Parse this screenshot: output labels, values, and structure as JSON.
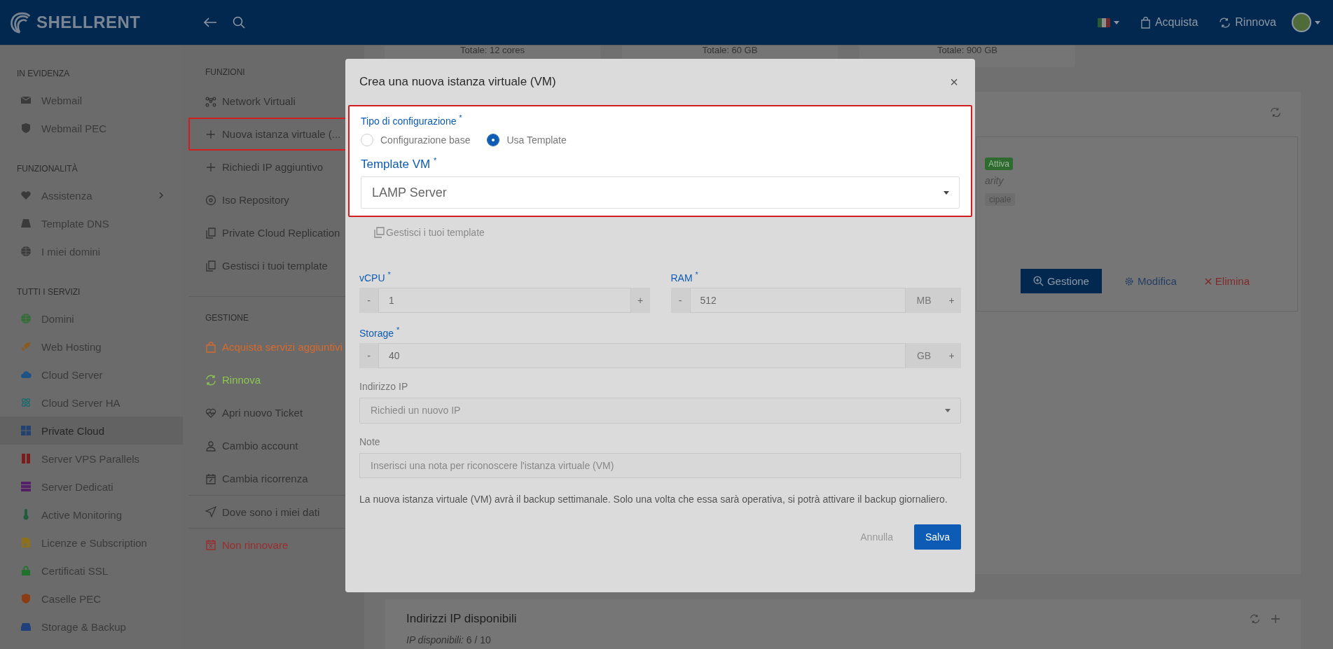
{
  "header": {
    "logo": "SHELLRENT",
    "nav": [
      {
        "label": "Acquista",
        "kind": "bag"
      },
      {
        "label": "Rinnova",
        "kind": "refresh"
      }
    ]
  },
  "sidebar": {
    "sections": [
      {
        "title": "IN EVIDENZA",
        "items": [
          {
            "label": "Webmail",
            "selected": false,
            "submenu": false
          },
          {
            "label": "Webmail PEC",
            "selected": false,
            "submenu": false
          }
        ]
      },
      {
        "title": "FUNZIONALITÀ",
        "items": [
          {
            "label": "Assistenza",
            "selected": false,
            "submenu": true
          },
          {
            "label": "Template DNS",
            "selected": false,
            "submenu": false
          },
          {
            "label": "I miei domini",
            "selected": false,
            "submenu": false
          }
        ]
      },
      {
        "title": "TUTTI I SERVIZI",
        "items": [
          {
            "label": "Domini",
            "selected": false,
            "submenu": false,
            "color": "#2f6e34"
          },
          {
            "label": "Web Hosting",
            "selected": false,
            "submenu": false,
            "color": "#8c5a1c"
          },
          {
            "label": "Cloud Server",
            "selected": false,
            "submenu": false,
            "color": "#1f5388"
          },
          {
            "label": "Cloud Server HA",
            "selected": false,
            "submenu": false,
            "color": "#1c6b6e"
          },
          {
            "label": "Private Cloud",
            "selected": true,
            "submenu": false,
            "color": "#24426e"
          },
          {
            "label": "Server VPS Parallels",
            "selected": false,
            "submenu": false,
            "color": "#7c1d1d"
          },
          {
            "label": "Server Dedicati",
            "selected": false,
            "submenu": false,
            "color": "#552067"
          },
          {
            "label": "Active Monitoring",
            "selected": false,
            "submenu": false,
            "color": "#1f5c3c"
          },
          {
            "label": "Licenze e Subscription",
            "selected": false,
            "submenu": false,
            "color": "#8c701e"
          },
          {
            "label": "Certificati SSL",
            "selected": false,
            "submenu": false,
            "color": "#1f722b"
          },
          {
            "label": "Caselle PEC",
            "selected": false,
            "submenu": false,
            "color": "#8c3c12"
          },
          {
            "label": "Storage & Backup",
            "selected": false,
            "submenu": false,
            "color": "#20407c"
          }
        ]
      }
    ]
  },
  "functions": {
    "sections": [
      {
        "title": "FUNZIONI",
        "items": [
          {
            "label": "Network Virtuali",
            "highlighted": false,
            "divider_before": false
          },
          {
            "label": "Nuova istanza virtuale (...",
            "highlighted": true,
            "divider_before": false
          },
          {
            "label": "Richiedi IP aggiuntivo",
            "highlighted": false,
            "divider_before": false
          },
          {
            "label": "Iso Repository",
            "highlighted": false,
            "divider_before": false
          },
          {
            "label": "Private Cloud Replication",
            "highlighted": false,
            "divider_before": false
          },
          {
            "label": "Gestisci i tuoi template",
            "highlighted": false,
            "divider_before": false
          }
        ]
      },
      {
        "title": "GESTIONE",
        "items": [
          {
            "label": "Acquista servizi aggiuntivi",
            "highlighted": false,
            "divider_before": false,
            "color": "#d86a2c"
          },
          {
            "label": "Rinnova",
            "highlighted": false,
            "divider_before": false,
            "color": "#8cc850"
          },
          {
            "label": "Apri nuovo Ticket",
            "highlighted": false,
            "divider_before": false
          },
          {
            "label": "Cambio account",
            "highlighted": false,
            "divider_before": false
          },
          {
            "label": "Cambia ricorrenza",
            "highlighted": false,
            "divider_before": false
          },
          {
            "label": "Dove sono i miei dati",
            "highlighted": false,
            "divider_before": true
          },
          {
            "label": "Non rinnovare",
            "highlighted": false,
            "divider_before": true,
            "color": "#9c2c2c"
          }
        ]
      }
    ]
  },
  "stats": [
    "Totale: 12 cores",
    "Totale: 60 GB",
    "Totale: 900 GB"
  ],
  "service_card": {
    "status": "Attiva",
    "subtitle": "arity",
    "tag": "cipale",
    "actions": [
      {
        "label": "Gestione",
        "kind": "primary"
      },
      {
        "label": "Modifica",
        "kind": "edit"
      },
      {
        "label": "Elimina",
        "kind": "delete"
      }
    ]
  },
  "ip_card": {
    "title": "Indirizzi IP disponibili",
    "summary": "*IP disponibili:* 6 / 10"
  },
  "modal": {
    "title": "Crea una nuova istanza virtuale (VM)",
    "close": "×",
    "configuration": {
      "spotlight": true,
      "label": "Tipo di configurazione",
      "asterisk": "*",
      "options": [
        {
          "label": "Configurazione base",
          "selected": false
        },
        {
          "label": "Usa Template",
          "selected": true
        }
      ],
      "template": {
        "label": "Template VM",
        "asterisk": "*",
        "value": "LAMP Server"
      }
    },
    "manage_link": "Gestisci i tuoi template",
    "vcpu": {
      "label": "vCPU",
      "asterisk": "*",
      "minus": "-",
      "value": "1",
      "plus": "+"
    },
    "ram": {
      "label": "RAM",
      "asterisk": "*",
      "minus": "-",
      "value": "512",
      "unit": "MB",
      "plus": "+"
    },
    "storage": {
      "label": "Storage",
      "asterisk": "*",
      "minus": "-",
      "value": "40",
      "unit": "GB",
      "plus": "+"
    },
    "ip": {
      "label": "Indirizzo IP",
      "placeholder": "Richiedi un nuovo IP"
    },
    "note": {
      "label": "Note",
      "placeholder": "Inserisci una nota per riconoscere l'istanza virtuale (VM)"
    },
    "info": "La nuova istanza virtuale (VM) avrà il backup settimanale. Solo una volta che essa sarà operativa, si potrà attivare il backup giornaliero.",
    "cancel": "Annulla",
    "save": "Salva"
  }
}
